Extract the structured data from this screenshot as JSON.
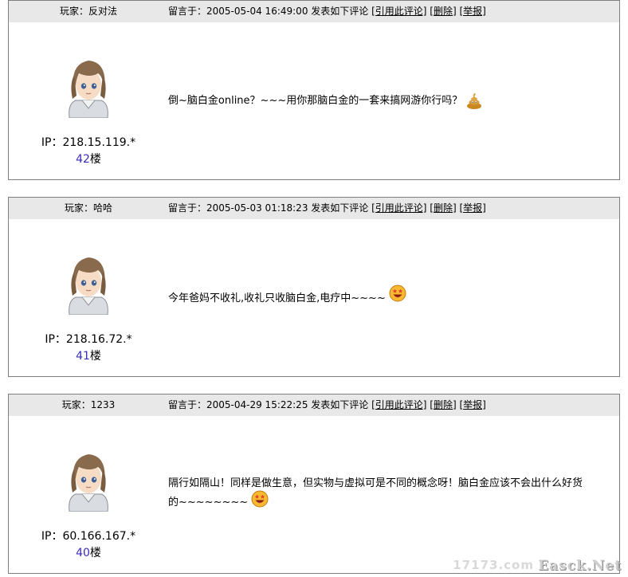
{
  "comments": [
    {
      "user_label": "玩家：反对法",
      "meta": "留言于：2005-05-04 16:49:00 发表如下评论",
      "actions": {
        "quote": "[引用此评论]",
        "delete": "[删除]",
        "report": "[举报]"
      },
      "ip": "IP：218.15.119.*",
      "floor_num": "42",
      "floor_suffix": "楼",
      "message_lines": [
        "倒~脑白金online？~~~用你那脑白金的一套来搞网游你行吗？"
      ],
      "emoji_icon": "poop-icon"
    },
    {
      "user_label": "玩家：哈哈",
      "meta": "留言于：2005-05-03 01:18:23 发表如下评论",
      "actions": {
        "quote": "[引用此评论]",
        "delete": "[删除]",
        "report": "[举报]"
      },
      "ip": "IP：218.16.72.*",
      "floor_num": "41",
      "floor_suffix": "楼",
      "message_lines": [
        "今年爸妈不收礼,收礼只收脑白金,电疗中~~~~"
      ],
      "emoji_icon": "star-eyes-face-icon"
    },
    {
      "user_label": "玩家：1233",
      "meta": "留言于：2005-04-29 15:22:25 发表如下评论",
      "actions": {
        "quote": "[引用此评论]",
        "delete": "[删除]",
        "report": "[举报]"
      },
      "ip": "IP：60.166.167.*",
      "floor_num": "40",
      "floor_suffix": "楼",
      "message_lines": [
        "隔行如隔山！同样是做生意，但实物与虚拟可是不同的概念呀！脑白金应该不会出什么好货",
        "的~~~~~~~~"
      ],
      "emoji_icon": "star-eyes-face-icon"
    }
  ],
  "watermark": {
    "site1": "17173.com",
    "site2": "Easck.Net"
  }
}
